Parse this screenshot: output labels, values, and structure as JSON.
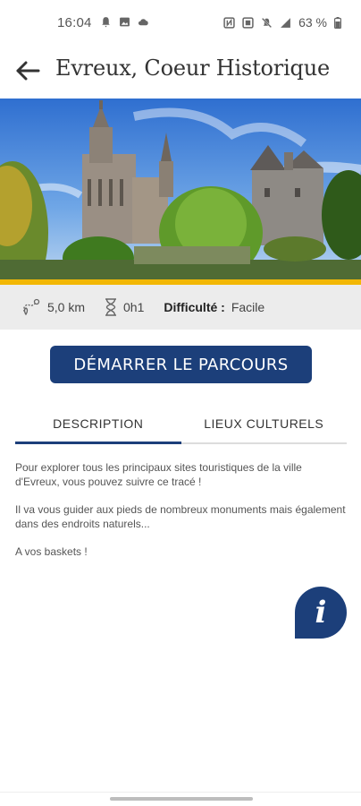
{
  "status": {
    "time": "16:04",
    "battery": "63 %"
  },
  "header": {
    "title": "Evreux, Coeur Historique"
  },
  "info": {
    "distance": "5,0 km",
    "duration": "0h1",
    "difficulty_label": "Difficulté :",
    "difficulty_value": "Facile"
  },
  "actions": {
    "start_label": "DÉMARRER LE PARCOURS"
  },
  "tabs": [
    {
      "label": "DESCRIPTION",
      "active": true
    },
    {
      "label": "LIEUX CULTURELS",
      "active": false
    }
  ],
  "description": {
    "p1": "Pour explorer tous les principaux sites touristiques de la ville d'Evreux, vous pouvez suivre ce tracé !",
    "p2": "Il va vous guider aux pieds de nombreux monuments mais également dans des endroits naturels...",
    "p3": "A vos baskets !"
  },
  "colors": {
    "brand": "#1c3f7a",
    "accent": "#f2b705"
  },
  "icons": {
    "back": "arrow-left-icon",
    "distance": "route-icon",
    "duration": "hourglass-icon",
    "info": "info-icon"
  }
}
